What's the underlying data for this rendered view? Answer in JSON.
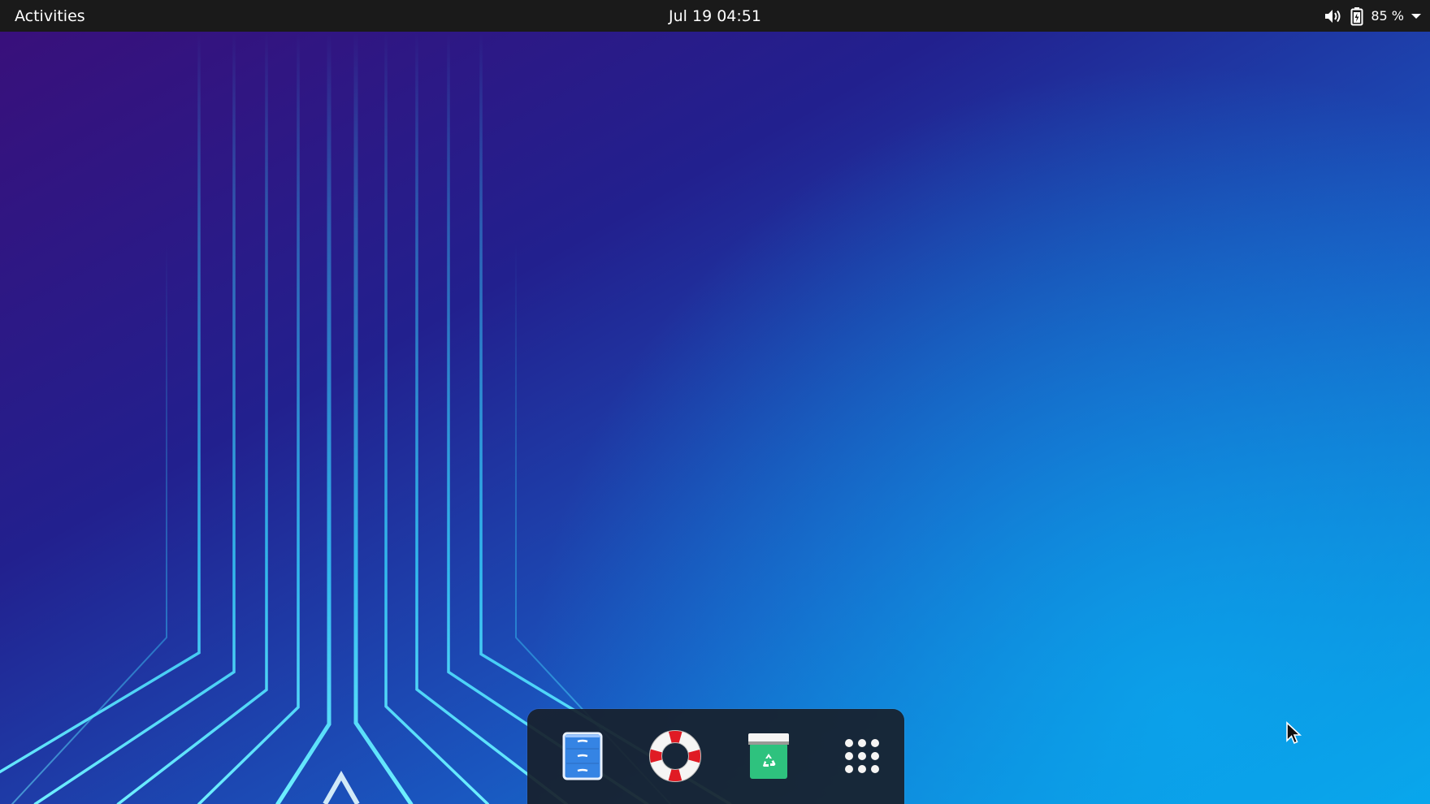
{
  "topbar": {
    "activities_label": "Activities",
    "clock": "Jul 19  04:51",
    "battery_percent": "85 %"
  },
  "status_icons": [
    "volume-icon",
    "battery-icon",
    "system-menu-arrow-icon"
  ],
  "dock": {
    "items": [
      {
        "name": "files",
        "icon": "file-cabinet-icon"
      },
      {
        "name": "help",
        "icon": "lifebuoy-icon"
      },
      {
        "name": "trash",
        "icon": "recycle-bin-icon"
      },
      {
        "name": "show-applications",
        "icon": "app-grid-icon"
      }
    ]
  },
  "colors": {
    "topbar_bg": "#1a1a1a",
    "wallpaper_purple": "#3a0f7a",
    "wallpaper_blue": "#1f45b8",
    "wallpaper_cyan": "#0aa3e6",
    "neon_line": "#38d8ff",
    "dock_bg": "#18202c",
    "files_blue": "#3584e4",
    "trash_green": "#2ec27e",
    "lifebuoy_red": "#e01b24"
  }
}
